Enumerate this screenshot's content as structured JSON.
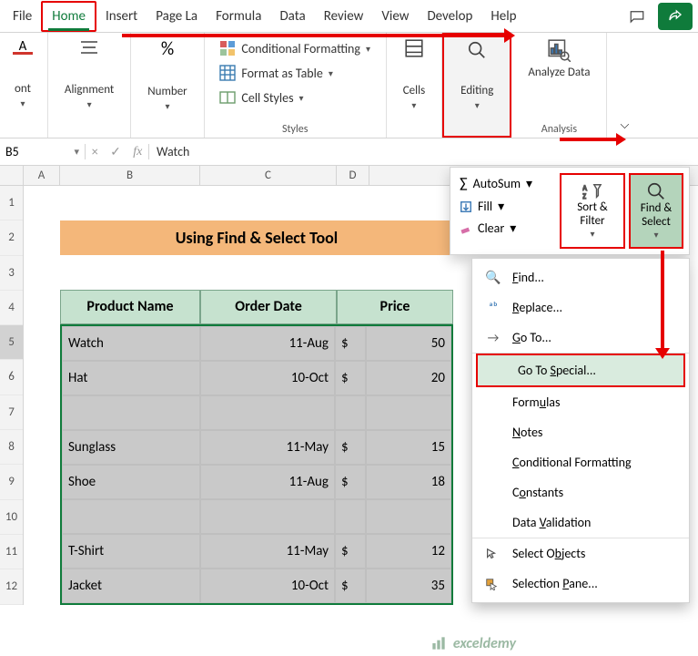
{
  "tabs": [
    "File",
    "Home",
    "Insert",
    "Page La",
    "Formula",
    "Data",
    "Review",
    "View",
    "Develop",
    "Help"
  ],
  "ribbon": {
    "font_group": "ont",
    "alignment": "Alignment",
    "number": "Number",
    "cond_fmt": "Conditional Formatting",
    "fmt_table": "Format as Table",
    "cell_styles": "Cell Styles",
    "styles_label": "Styles",
    "cells": "Cells",
    "editing": "Editing",
    "analyze": "Analyze Data",
    "analysis_label": "Analysis"
  },
  "editing_panel": {
    "autosum": "AutoSum",
    "fill": "Fill",
    "clear": "Clear",
    "sort_filter": "Sort & Filter",
    "find_select": "Find & Select"
  },
  "fs_menu": {
    "find": "Find...",
    "replace": "Replace...",
    "goto": "Go To...",
    "goto_special": "Go To Special...",
    "formulas": "Formulas",
    "notes": "Notes",
    "cond_fmt": "Conditional Formatting",
    "constants": "Constants",
    "data_val": "Data Validation",
    "sel_objects": "Select Objects",
    "sel_pane": "Selection Pane..."
  },
  "namebox": "B5",
  "formula_value": "Watch",
  "col_headers": [
    "A",
    "B",
    "C",
    "D"
  ],
  "row_headers": [
    "1",
    "2",
    "3",
    "4",
    "5",
    "6",
    "7",
    "8",
    "9",
    "10",
    "11",
    "12"
  ],
  "title_banner": "Using Find & Select Tool",
  "table_headers": [
    "Product Name",
    "Order Date",
    "Price"
  ],
  "chart_data": {
    "type": "table",
    "columns": [
      "Product Name",
      "Order Date",
      "Price"
    ],
    "rows": [
      {
        "product": "Watch",
        "date": "11-Aug",
        "cur": "$",
        "price": 50
      },
      {
        "product": "Hat",
        "date": "10-Oct",
        "cur": "$",
        "price": 20
      },
      {
        "product": "",
        "date": "",
        "cur": "",
        "price": ""
      },
      {
        "product": "Sunglass",
        "date": "11-May",
        "cur": "$",
        "price": 15
      },
      {
        "product": "Shoe",
        "date": "11-Aug",
        "cur": "$",
        "price": 18
      },
      {
        "product": "",
        "date": "",
        "cur": "",
        "price": ""
      },
      {
        "product": "T-Shirt",
        "date": "11-May",
        "cur": "$",
        "price": 12
      },
      {
        "product": "Jacket",
        "date": "10-Oct",
        "cur": "$",
        "price": 35
      }
    ]
  },
  "watermark": "exceldemy"
}
